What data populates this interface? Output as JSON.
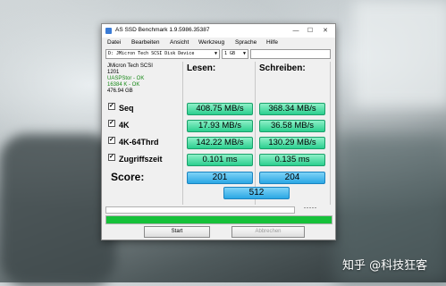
{
  "window": {
    "title": "AS SSD Benchmark 1.9.5986.35387",
    "controls": {
      "minimize": "—",
      "maximize": "☐",
      "close": "✕"
    }
  },
  "menu": [
    "Datei",
    "Bearbeiten",
    "Ansicht",
    "Werkzeug",
    "Sprache",
    "Hilfe"
  ],
  "toolbar": {
    "drive_value": "D: JMicron Tech SCSI Disk Device",
    "size_value": "1 GB",
    "size_field_value": ""
  },
  "drive_info": {
    "name": "JMicron Tech SCSI",
    "firmware": "1201",
    "driver": "UASPStor - OK",
    "alignment": "16384 K - OK",
    "capacity": "476.94 GB"
  },
  "headers": {
    "read": "Lesen:",
    "write": "Schreiben:"
  },
  "rows": [
    {
      "label": "Seq",
      "read": "408.75 MB/s",
      "write": "368.34 MB/s"
    },
    {
      "label": "4K",
      "read": "17.93 MB/s",
      "write": "36.58 MB/s"
    },
    {
      "label": "4K-64Thrd",
      "read": "142.22 MB/s",
      "write": "130.29 MB/s"
    },
    {
      "label": "Zugriffszeit",
      "read": "0.101 ms",
      "write": "0.135 ms"
    }
  ],
  "score": {
    "label": "Score:",
    "read": "201",
    "write": "204",
    "total": "512"
  },
  "status": {
    "mini_text": "-----",
    "progress_percent": 100
  },
  "buttons": {
    "start": "Start",
    "abort": "Abbrechen"
  },
  "watermark": "知乎 @科技狂客",
  "colors": {
    "result_green": "#2bcf8f",
    "score_blue": "#2aa7e4",
    "progress_green": "#16c13a"
  }
}
